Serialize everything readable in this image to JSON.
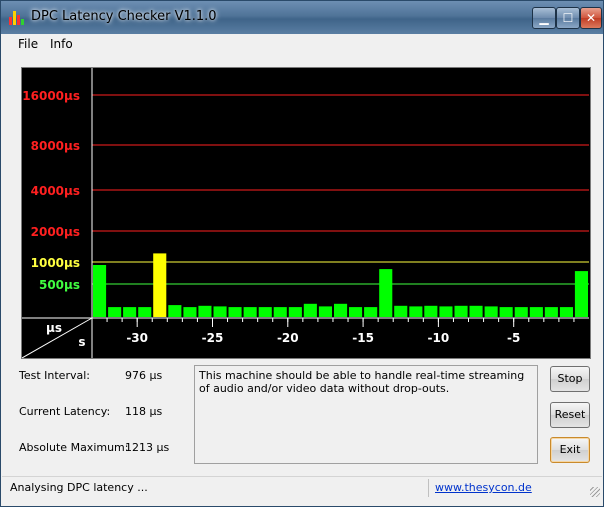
{
  "window": {
    "title": "DPC Latency Checker V1.1.0",
    "controls": {
      "minimize": "▁",
      "maximize": "☐",
      "close": "✕"
    }
  },
  "menu": [
    "File",
    "Info"
  ],
  "chart_data": {
    "type": "bar",
    "y_tick_labels": [
      "16000µs",
      "8000µs",
      "4000µs",
      "2000µs",
      "1000µs",
      "500µs"
    ],
    "y_tick_values": [
      16000,
      8000,
      4000,
      2000,
      1000,
      500
    ],
    "y_tick_colors": [
      "#ff2020",
      "#ff2020",
      "#ff2020",
      "#ff2020",
      "#ffff40",
      "#40ff40"
    ],
    "x_tick_labels": [
      "-30",
      "-25",
      "-20",
      "-15",
      "-10",
      "-5"
    ],
    "x_tick_values": [
      -30,
      -25,
      -20,
      -15,
      -10,
      -5
    ],
    "xlim": [
      -33,
      0
    ],
    "corner_labels": {
      "top": "µs",
      "bottom": "s"
    },
    "x": [
      -32.5,
      -31.5,
      -30.5,
      -29.5,
      -28.5,
      -27.5,
      -26.5,
      -25.5,
      -24.5,
      -23.5,
      -22.5,
      -21.5,
      -20.5,
      -19.5,
      -18.5,
      -17.5,
      -16.5,
      -15.5,
      -14.5,
      -13.5,
      -12.5,
      -11.5,
      -10.5,
      -9.5,
      -8.5,
      -7.5,
      -6.5,
      -5.5,
      -4.5,
      -3.5,
      -2.5,
      -1.5,
      -0.5
    ],
    "values": [
      910,
      150,
      150,
      150,
      1213,
      180,
      150,
      170,
      160,
      150,
      150,
      150,
      150,
      150,
      200,
      160,
      200,
      150,
      150,
      800,
      170,
      160,
      170,
      160,
      170,
      170,
      160,
      150,
      150,
      150,
      150,
      150,
      750
    ],
    "bar_colors": [
      "#00ff00",
      "#00ff00",
      "#00ff00",
      "#00ff00",
      "#ffff00",
      "#00ff00",
      "#00ff00",
      "#00ff00",
      "#00ff00",
      "#00ff00",
      "#00ff00",
      "#00ff00",
      "#00ff00",
      "#00ff00",
      "#00ff00",
      "#00ff00",
      "#00ff00",
      "#00ff00",
      "#00ff00",
      "#00ff00",
      "#00ff00",
      "#00ff00",
      "#00ff00",
      "#00ff00",
      "#00ff00",
      "#00ff00",
      "#00ff00",
      "#00ff00",
      "#00ff00",
      "#00ff00",
      "#00ff00",
      "#00ff00",
      "#00ff00"
    ],
    "background": "#000000",
    "grid": true
  },
  "info": {
    "test_interval_label": "Test Interval:",
    "test_interval_value": "976 µs",
    "current_latency_label": "Current Latency:",
    "current_latency_value": "118 µs",
    "absolute_maximum_label": "Absolute Maximum:",
    "absolute_maximum_value": "1213 µs"
  },
  "message": "This machine should be able to handle real-time streaming of audio and/or video data without drop-outs.",
  "buttons": {
    "stop": "Stop",
    "reset": "Reset",
    "exit": "Exit"
  },
  "status": {
    "text": "Analysing DPC latency ...",
    "link": "www.thesycon.de"
  }
}
